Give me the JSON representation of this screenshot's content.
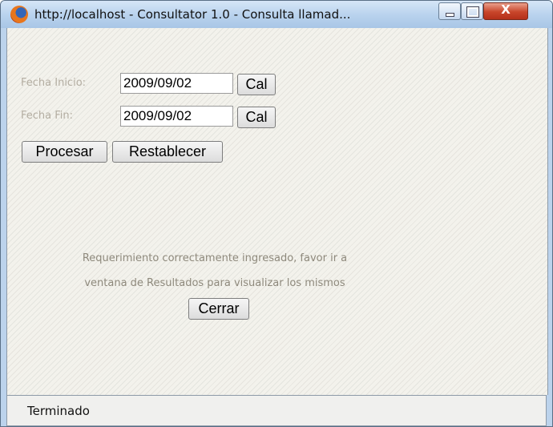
{
  "window": {
    "title": "http://localhost - Consultator 1.0 - Consulta llamad...",
    "icon": "firefox-icon",
    "controls": {
      "minimize": "minimize-icon",
      "maximize": "maximize-icon",
      "close_glyph": "X"
    }
  },
  "form": {
    "fecha_inicio": {
      "label": "Fecha Inicio:",
      "value": "2009/09/02",
      "cal_button": "Cal"
    },
    "fecha_fin": {
      "label": "Fecha Fin:",
      "value": "2009/09/02",
      "cal_button": "Cal"
    },
    "procesar_label": "Procesar",
    "restablecer_label": "Restablecer"
  },
  "message": {
    "line1": "Requerimiento correctamente ingresado, favor ir a",
    "line2": "ventana de Resultados para visualizar los mismos",
    "close_label": "Cerrar"
  },
  "statusbar": {
    "text": "Terminado"
  },
  "colors": {
    "titlebar": "#bad3ee",
    "close_button": "#c8452a",
    "content_background": "#f3f2ec",
    "label_text": "#b3ada1",
    "message_text": "#8e897c"
  }
}
